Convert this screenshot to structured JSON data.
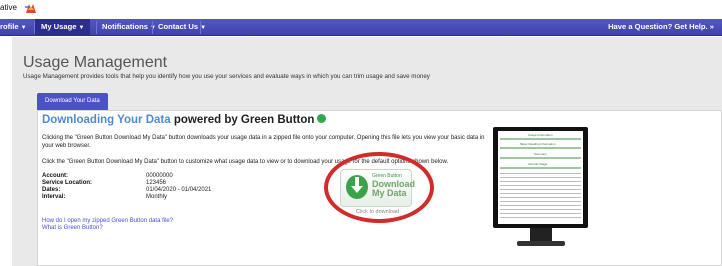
{
  "brand": {
    "text": "ative"
  },
  "nav": {
    "items": [
      {
        "label": "rofile",
        "caret": "▼"
      },
      {
        "label": "My Usage",
        "caret": "▼"
      },
      {
        "label": "Notifications",
        "caret": "▼"
      },
      {
        "label": "Contact Us",
        "caret": "▼"
      }
    ],
    "help": "Have a Question? Get Help. »"
  },
  "page": {
    "title": "Usage Management",
    "subtitle": "Usage Management provides tools that help you identify how you use your services and evaluate ways in which you can trim usage and save money",
    "tab": "Download Your Data"
  },
  "content": {
    "heading_blue": "Downloading Your Data",
    "heading_dark": " powered by Green Button",
    "para1_line1": "Clicking the \"Green Button Download My Data\" button downloads your usage data in a zipped file onto your computer. Opening this file lets you view your basic data in",
    "para1_line2": "your web browser.",
    "para2": "Click the \"Green Button Download My Data\" button to customize what usage data to view or to download your usage for the default options shown below.",
    "info": [
      {
        "label": "Account:",
        "value": "00000000"
      },
      {
        "label": "Service Location:",
        "value": "123456"
      },
      {
        "label": "Dates:",
        "value": "01/04/2020 - 01/04/2021"
      },
      {
        "label": "Interval:",
        "value": "Monthly"
      }
    ],
    "links": [
      "How do I open my zipped Green Button data file?",
      "What is Green Button?"
    ],
    "button": {
      "line1": "Green Button",
      "line2": "Download",
      "line3": "My Data",
      "under": "Click to download"
    },
    "monitor": {
      "line1": "Usage Information",
      "line2": "Meter Reading Information",
      "line3": "Summary",
      "line4": "Interval Usage"
    }
  },
  "colors": {
    "nav": "#4a50c0",
    "accent_blue": "#4e8ad2",
    "green": "#2fa84f",
    "ring": "#d22b2b"
  }
}
